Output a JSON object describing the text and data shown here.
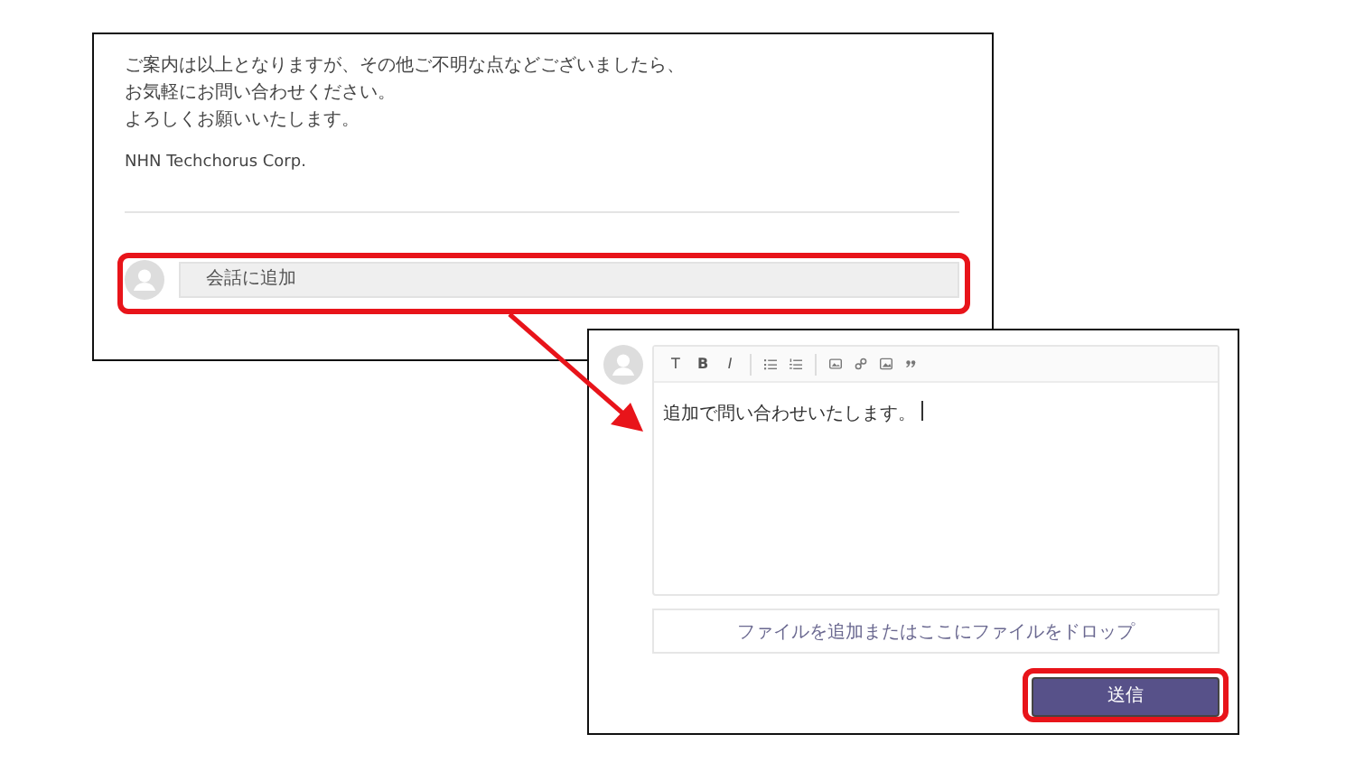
{
  "email_panel": {
    "body_lines": [
      "ご案内は以上となりますが、その他ご不明な点などございましたら、",
      "お気軽にお問い合わせください。",
      "よろしくお願いいたします。"
    ],
    "signature": "NHN Techchorus Corp.",
    "comment_field": {
      "placeholder": "会話に追加",
      "highlighted": true
    }
  },
  "editor_panel": {
    "format_buttons": [
      {
        "label": "T",
        "kind": "plain"
      },
      {
        "label": "B",
        "kind": "bold"
      },
      {
        "label": "I",
        "kind": "italic"
      }
    ],
    "icon_buttons": [
      {
        "kind": "bullet-list"
      },
      {
        "kind": "numbered-list"
      },
      {
        "kind": "image"
      },
      {
        "kind": "link"
      },
      {
        "kind": "picture"
      },
      {
        "kind": "quote"
      }
    ],
    "value": "追加で問い合わせいたします。",
    "dropzone": "ファイルを追加またはここにファイルをドロップ",
    "send_button": {
      "label": "送信",
      "highlighted": true
    }
  }
}
